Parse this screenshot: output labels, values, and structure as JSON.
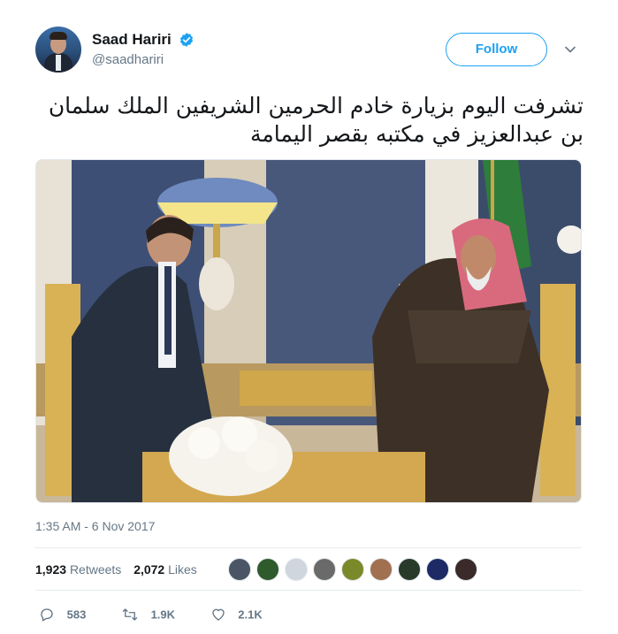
{
  "user": {
    "display_name": "Saad Hariri",
    "handle": "@saadhariri",
    "verified": true
  },
  "follow_label": "Follow",
  "tweet": {
    "text": "تشرفت اليوم بزيارة خادم الحرمين الشريفين الملك سلمان بن عبدالعزيز في مكتبه بقصر اليمامة",
    "timestamp": "1:35 AM - 6 Nov 2017"
  },
  "stats": {
    "retweets_count": "1,923",
    "retweets_label": "Retweets",
    "likes_count": "2,072",
    "likes_label": "Likes"
  },
  "likers": [
    {
      "color": "#4a5566"
    },
    {
      "color": "#2f5a2c"
    },
    {
      "color": "#cfd6dd"
    },
    {
      "color": "#6a6a6a"
    },
    {
      "color": "#7a8a2a"
    },
    {
      "color": "#a07050"
    },
    {
      "color": "#2a3a2a"
    },
    {
      "color": "#1d2a66"
    },
    {
      "color": "#3a2a2a"
    }
  ],
  "actions": {
    "replies": "583",
    "retweets": "1.9K",
    "likes": "2.1K"
  },
  "colors": {
    "accent": "#1da1f2",
    "muted": "#657786",
    "text": "#14171a"
  }
}
